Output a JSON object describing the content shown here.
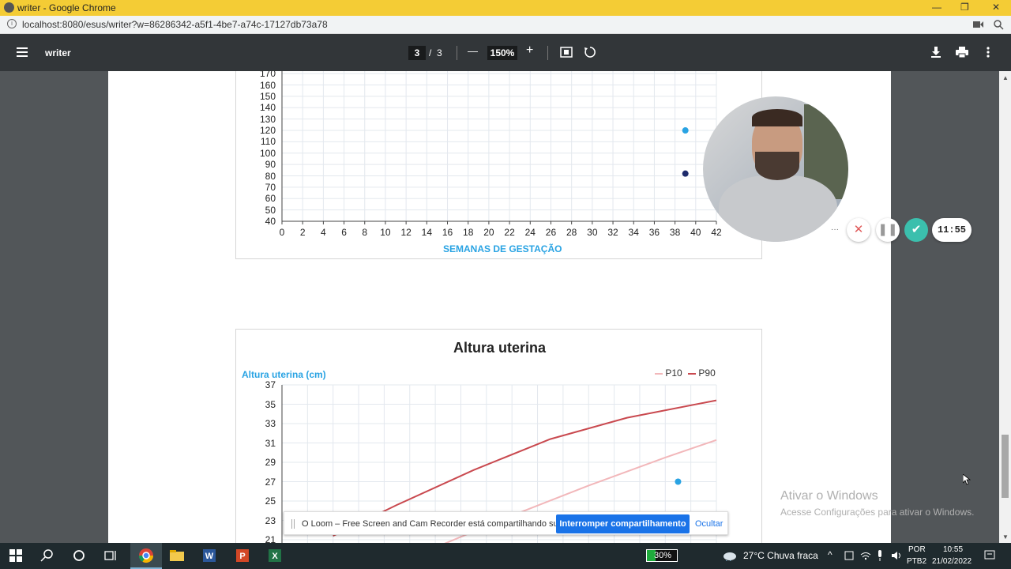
{
  "window": {
    "title": "writer - Google Chrome",
    "minimize": "—",
    "restore": "❐",
    "close": "✕"
  },
  "address": {
    "url": "localhost:8080/esus/writer?w=86286342-a5f1-4be7-a74c-17127db73a78"
  },
  "pdf_toolbar": {
    "doc_name": "writer",
    "page_current": "3",
    "page_sep": "/",
    "page_total": "3",
    "zoom": "150%",
    "minus": "—",
    "plus": "+"
  },
  "chart_data": [
    {
      "type": "scatter",
      "xlabel": "SEMANAS DE GESTAÇÃO",
      "x_ticks": [
        "0",
        "2",
        "4",
        "6",
        "8",
        "10",
        "12",
        "14",
        "16",
        "18",
        "20",
        "22",
        "24",
        "26",
        "28",
        "30",
        "32",
        "34",
        "36",
        "38",
        "40",
        "42"
      ],
      "y_ticks": [
        "170",
        "160",
        "150",
        "140",
        "130",
        "120",
        "110",
        "100",
        "90",
        "80",
        "70",
        "60",
        "50",
        "40"
      ],
      "xlim": [
        0,
        42
      ],
      "ylim": [
        40,
        175
      ],
      "points": [
        {
          "x": 39,
          "y": 120,
          "color": "#29a3e3"
        },
        {
          "x": 39,
          "y": 82,
          "color": "#1d2a6b"
        }
      ]
    },
    {
      "type": "line",
      "title": "Altura uterina",
      "ylabel": "Altura uterina (cm)",
      "legend": [
        "P10",
        "P90"
      ],
      "legend_position": "top-right",
      "y_ticks": [
        "37",
        "35",
        "33",
        "31",
        "29",
        "27",
        "25",
        "23",
        "21"
      ],
      "ylim": [
        21,
        37
      ],
      "series": [
        {
          "name": "P10",
          "color": "#f2b7ba",
          "x": [
            20,
            26,
            32,
            38,
            42
          ],
          "y": [
            20.2,
            23.5,
            26.6,
            29.5,
            31.3
          ]
        },
        {
          "name": "P90",
          "color": "#c9494f",
          "x": [
            12,
            17,
            23,
            29,
            35,
            42
          ],
          "y": [
            21.4,
            24.6,
            28.2,
            31.4,
            33.6,
            35.4
          ]
        }
      ],
      "points": [
        {
          "x": 39,
          "y": 27,
          "color": "#29a3e3"
        }
      ]
    }
  ],
  "loom_bar": {
    "message": "O Loom – Free Screen and Cam Recorder está compartilhando sua tela.",
    "stop_label": "Interromper compartilhamento",
    "hide_label": "Ocultar"
  },
  "recorder": {
    "timer": "11:55",
    "more": "···"
  },
  "watermark": {
    "line1": "Ativar o Windows",
    "line2": "Acesse Configurações para ativar o Windows."
  },
  "taskbar": {
    "battery": "30%",
    "weather": "27°C  Chuva fraca",
    "lang1": "POR",
    "lang2": "PTB2",
    "time": "10:55",
    "date": "21/02/2022"
  }
}
